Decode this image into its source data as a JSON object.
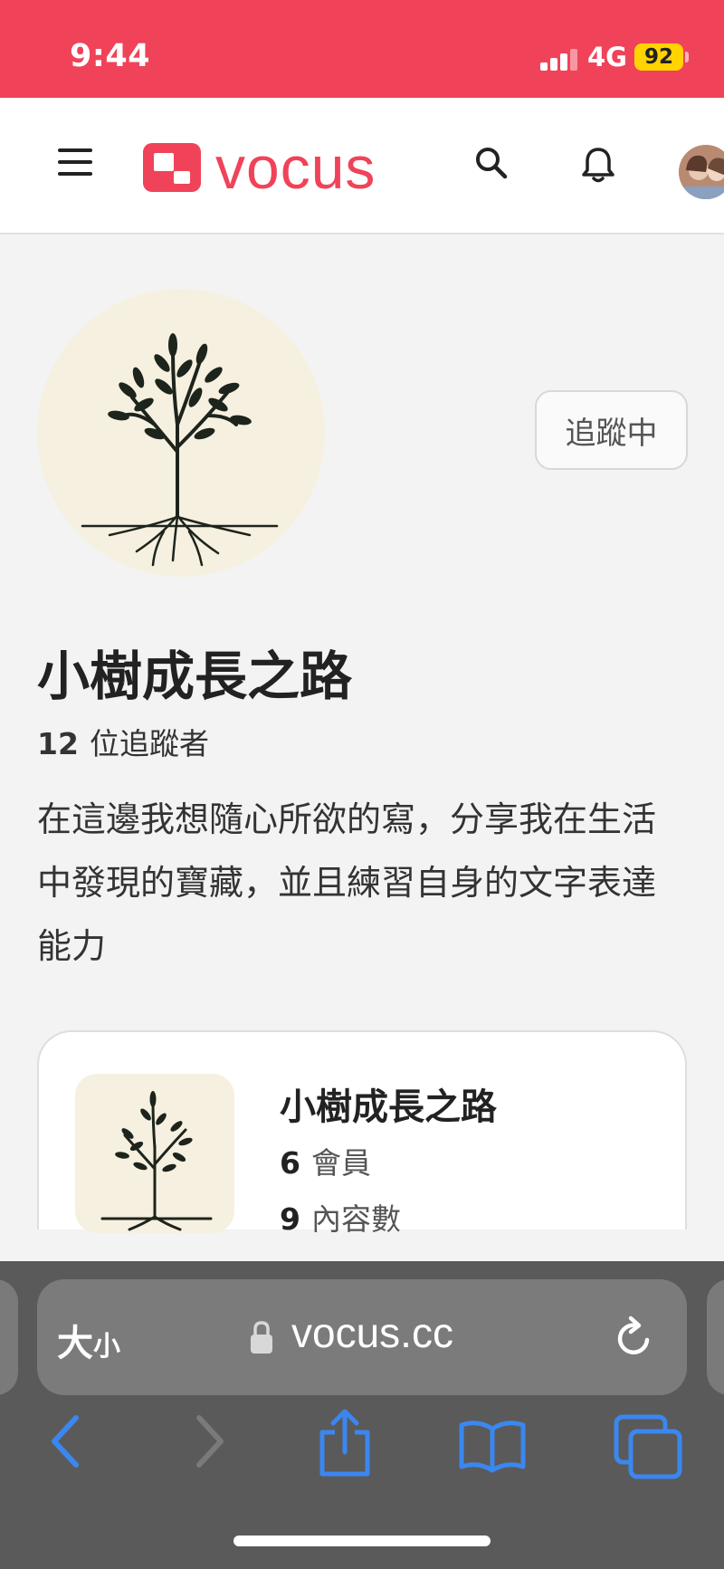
{
  "status_bar": {
    "time": "9:44",
    "network": "4G",
    "battery": "92"
  },
  "header": {
    "logo_text": "vocus",
    "accent_color": "#f04359"
  },
  "profile": {
    "follow_button": "追蹤中",
    "name": "小樹成長之路",
    "followers_count": "12",
    "followers_label": "位追蹤者",
    "bio": "在這邊我想隨心所欲的寫，分享我在生活中發現的寶藏，並且練習自身的文字表達能力"
  },
  "card": {
    "title": "小樹成長之路",
    "members_count": "6",
    "members_label": "會員",
    "content_count": "9",
    "content_label": "內容數"
  },
  "browser": {
    "text_size_big": "大",
    "text_size_small": "小",
    "url": "vocus.cc"
  },
  "icons": [
    "menu-icon",
    "search-icon",
    "bell-icon",
    "lock-icon",
    "reload-icon",
    "back-icon",
    "forward-icon",
    "share-icon",
    "bookmarks-icon",
    "tabs-icon"
  ]
}
